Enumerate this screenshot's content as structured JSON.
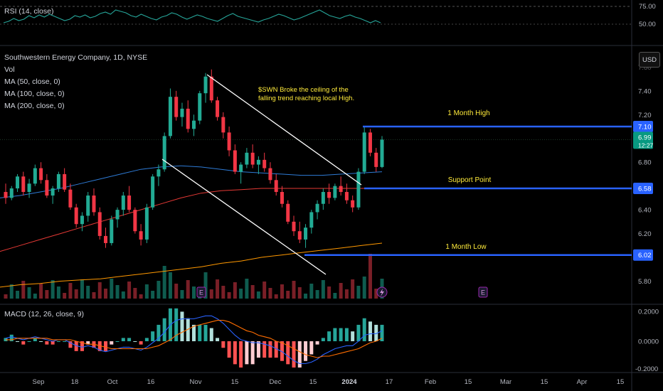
{
  "rsi_panel": {
    "label": "RSI (14, close)",
    "ticks": [
      "75.00",
      "50.00"
    ],
    "values": [
      52,
      54,
      58,
      55,
      57,
      62,
      59,
      63,
      60,
      64,
      61,
      58,
      55,
      57,
      62,
      60,
      63,
      59,
      61,
      65,
      67,
      64,
      70,
      68,
      66,
      62,
      60,
      64,
      61,
      58,
      56,
      60,
      62,
      66,
      64,
      60,
      57,
      60,
      63,
      61,
      58,
      56,
      54,
      58,
      62,
      65,
      61,
      59,
      57,
      55,
      53,
      56,
      58,
      61,
      64,
      62,
      59,
      56,
      58,
      61,
      64,
      67,
      70,
      66,
      62,
      60,
      58,
      61,
      63,
      60,
      58,
      55,
      52,
      55,
      52
    ]
  },
  "price_panel": {
    "legend": [
      "Southwestern Energy Company, 1D, NYSE",
      "Vol",
      "MA (50, close, 0)",
      "MA (100, close, 0)",
      "MA (200, close, 0)"
    ],
    "currency": "USD",
    "ticks": [
      "7.40",
      "7.20",
      "7.10",
      "6.80",
      "6.58",
      "6.40",
      "6.20",
      "6.02",
      "5.80"
    ],
    "last_price": "6.99",
    "countdown": "12:27",
    "annotation_main": [
      "$SWN Broke the ceiling of the",
      "falling trend reaching local High."
    ],
    "levels": [
      {
        "label": "1 Month High",
        "price": 7.1,
        "tag": "7.10"
      },
      {
        "label": "Support Point",
        "price": 6.58,
        "tag": "6.58"
      },
      {
        "label": "1 Month Low",
        "price": 6.02,
        "tag": "6.02"
      }
    ],
    "earnings_markers": [
      "E",
      "E"
    ]
  },
  "macd_panel": {
    "label": "MACD (12, 26, close, 9)",
    "ticks": [
      "0.2000",
      "0.0000",
      "-0.2000"
    ]
  },
  "x_axis": {
    "labels": [
      "Sep",
      "18",
      "Oct",
      "16",
      "Nov",
      "15",
      "Dec",
      "15",
      "2024",
      "17",
      "Feb",
      "15",
      "Mar",
      "15",
      "Apr",
      "15"
    ]
  },
  "colors": {
    "up": "#22ab94",
    "down": "#f23645",
    "level": "#2962ff",
    "ma50": "#2e7bd6",
    "ma100": "#e53935",
    "ma200": "#ff9800",
    "annotation": "#ffeb3b",
    "last_price_bg": "#089981"
  },
  "chart_data": [
    {
      "type": "line",
      "title": "RSI (14, close)",
      "ylim": [
        40,
        80
      ],
      "series": [
        {
          "name": "RSI",
          "values": "see rsi_panel.values"
        }
      ]
    },
    {
      "type": "candlestick",
      "title": "Southwestern Energy Company, 1D, NYSE",
      "ylabel": "USD",
      "ylim": [
        5.75,
        7.6
      ],
      "x_range": [
        "2023-08-29",
        "2024-01-12"
      ],
      "candles": [
        [
          6.55,
          6.62,
          6.45,
          6.5
        ],
        [
          6.5,
          6.6,
          6.48,
          6.58
        ],
        [
          6.58,
          6.7,
          6.55,
          6.68
        ],
        [
          6.68,
          6.72,
          6.52,
          6.55
        ],
        [
          6.55,
          6.66,
          6.5,
          6.62
        ],
        [
          6.62,
          6.78,
          6.6,
          6.75
        ],
        [
          6.75,
          6.8,
          6.62,
          6.65
        ],
        [
          6.65,
          6.7,
          6.5,
          6.52
        ],
        [
          6.52,
          6.6,
          6.45,
          6.58
        ],
        [
          6.58,
          6.72,
          6.55,
          6.7
        ],
        [
          6.7,
          6.75,
          6.55,
          6.57
        ],
        [
          6.57,
          6.62,
          6.4,
          6.42
        ],
        [
          6.42,
          6.45,
          6.25,
          6.28
        ],
        [
          6.28,
          6.38,
          6.22,
          6.35
        ],
        [
          6.35,
          6.55,
          6.3,
          6.52
        ],
        [
          6.52,
          6.58,
          6.35,
          6.38
        ],
        [
          6.38,
          6.42,
          6.15,
          6.18
        ],
        [
          6.18,
          6.25,
          6.08,
          6.12
        ],
        [
          6.12,
          6.35,
          6.1,
          6.32
        ],
        [
          6.32,
          6.42,
          6.25,
          6.4
        ],
        [
          6.4,
          6.55,
          6.35,
          6.52
        ],
        [
          6.52,
          6.6,
          6.38,
          6.4
        ],
        [
          6.4,
          6.42,
          6.2,
          6.22
        ],
        [
          6.22,
          6.28,
          6.1,
          6.15
        ],
        [
          6.15,
          6.45,
          6.12,
          6.42
        ],
        [
          6.42,
          6.7,
          6.4,
          6.68
        ],
        [
          6.68,
          6.78,
          6.6,
          6.74
        ],
        [
          6.74,
          7.05,
          6.72,
          7.02
        ],
        [
          7.02,
          7.42,
          7.0,
          7.35
        ],
        [
          7.35,
          7.4,
          7.15,
          7.18
        ],
        [
          7.18,
          7.3,
          7.1,
          7.25
        ],
        [
          7.25,
          7.32,
          7.05,
          7.08
        ],
        [
          7.08,
          7.2,
          7.02,
          7.15
        ],
        [
          7.15,
          7.4,
          7.12,
          7.38
        ],
        [
          7.38,
          7.55,
          7.3,
          7.52
        ],
        [
          7.52,
          7.58,
          7.3,
          7.32
        ],
        [
          7.32,
          7.35,
          7.15,
          7.18
        ],
        [
          7.18,
          7.22,
          7.0,
          7.05
        ],
        [
          7.05,
          7.1,
          6.85,
          6.9
        ],
        [
          6.9,
          6.95,
          6.7,
          6.72
        ],
        [
          6.72,
          6.8,
          6.62,
          6.78
        ],
        [
          6.78,
          6.92,
          6.75,
          6.88
        ],
        [
          6.88,
          6.95,
          6.75,
          6.78
        ],
        [
          6.78,
          6.85,
          6.7,
          6.82
        ],
        [
          6.82,
          6.88,
          6.72,
          6.75
        ],
        [
          6.75,
          6.8,
          6.62,
          6.65
        ],
        [
          6.65,
          6.7,
          6.52,
          6.55
        ],
        [
          6.55,
          6.6,
          6.42,
          6.45
        ],
        [
          6.45,
          6.48,
          6.28,
          6.3
        ],
        [
          6.3,
          6.35,
          6.18,
          6.22
        ],
        [
          6.22,
          6.3,
          6.12,
          6.15
        ],
        [
          6.15,
          6.28,
          6.08,
          6.25
        ],
        [
          6.25,
          6.4,
          6.2,
          6.38
        ],
        [
          6.38,
          6.48,
          6.32,
          6.45
        ],
        [
          6.45,
          6.58,
          6.4,
          6.55
        ],
        [
          6.55,
          6.62,
          6.45,
          6.5
        ],
        [
          6.5,
          6.62,
          6.48,
          6.6
        ],
        [
          6.6,
          6.68,
          6.52,
          6.55
        ],
        [
          6.55,
          6.62,
          6.45,
          6.48
        ],
        [
          6.48,
          6.52,
          6.38,
          6.42
        ],
        [
          6.42,
          6.75,
          6.4,
          6.72
        ],
        [
          6.72,
          7.1,
          6.7,
          7.05
        ],
        [
          7.05,
          7.08,
          6.85,
          6.88
        ],
        [
          6.88,
          6.92,
          6.72,
          6.76
        ],
        [
          6.76,
          7.02,
          6.75,
          6.99
        ]
      ],
      "moving_averages": [
        {
          "name": "MA (50, close, 0)",
          "values": [
            6.5,
            6.52,
            6.55,
            6.58,
            6.62,
            6.66,
            6.7,
            6.74,
            6.76,
            6.77,
            6.76,
            6.74,
            6.72,
            6.71,
            6.7,
            6.69,
            6.69,
            6.7,
            6.71,
            6.72
          ]
        },
        {
          "name": "MA (100, close, 0)",
          "values": [
            6.05,
            6.1,
            6.15,
            6.2,
            6.25,
            6.3,
            6.35,
            6.4,
            6.45,
            6.5,
            6.54,
            6.56,
            6.57,
            6.58,
            6.58,
            6.58,
            6.58,
            6.58,
            6.58,
            6.58
          ]
        },
        {
          "name": "MA (200, close, 0)",
          "values": [
            5.75,
            5.77,
            5.78,
            5.8,
            5.81,
            5.82,
            5.84,
            5.86,
            5.88,
            5.9,
            5.92,
            5.95,
            5.97,
            6.0,
            6.02,
            6.04,
            6.06,
            6.08,
            6.1,
            6.12
          ]
        }
      ]
    },
    {
      "type": "bar",
      "title": "MACD (12, 26, close, 9)",
      "ylim": [
        -0.2,
        0.2
      ],
      "series": [
        {
          "name": "MACD",
          "values": [
            0.02,
            0.03,
            0.02,
            0.01,
            0.02,
            0.03,
            0.02,
            0.01,
            0.0,
            0.01,
            0.01,
            -0.01,
            -0.03,
            -0.04,
            -0.03,
            -0.04,
            -0.06,
            -0.07,
            -0.06,
            -0.05,
            -0.04,
            -0.04,
            -0.05,
            -0.06,
            -0.04,
            -0.01,
            0.02,
            0.06,
            0.11,
            0.14,
            0.15,
            0.15,
            0.15,
            0.16,
            0.17,
            0.17,
            0.15,
            0.12,
            0.08,
            0.04,
            0.01,
            0.0,
            -0.01,
            -0.01,
            -0.02,
            -0.03,
            -0.05,
            -0.07,
            -0.1,
            -0.13,
            -0.15,
            -0.15,
            -0.14,
            -0.12,
            -0.09,
            -0.07,
            -0.05,
            -0.04,
            -0.03,
            -0.03,
            0.0,
            0.04,
            0.05,
            0.05,
            0.07
          ]
        },
        {
          "name": "Signal",
          "values": [
            0.01,
            0.01,
            0.02,
            0.02,
            0.02,
            0.02,
            0.02,
            0.02,
            0.01,
            0.01,
            0.01,
            0.01,
            0.0,
            -0.01,
            -0.02,
            -0.02,
            -0.03,
            -0.04,
            -0.05,
            -0.05,
            -0.05,
            -0.05,
            -0.05,
            -0.05,
            -0.05,
            -0.04,
            -0.03,
            -0.01,
            0.01,
            0.04,
            0.06,
            0.08,
            0.1,
            0.11,
            0.12,
            0.13,
            0.14,
            0.14,
            0.13,
            0.11,
            0.09,
            0.07,
            0.06,
            0.04,
            0.03,
            0.02,
            0.0,
            -0.01,
            -0.03,
            -0.05,
            -0.07,
            -0.09,
            -0.1,
            -0.11,
            -0.1,
            -0.1,
            -0.09,
            -0.08,
            -0.07,
            -0.06,
            -0.05,
            -0.03,
            -0.01,
            0.0,
            0.02
          ]
        }
      ]
    }
  ]
}
